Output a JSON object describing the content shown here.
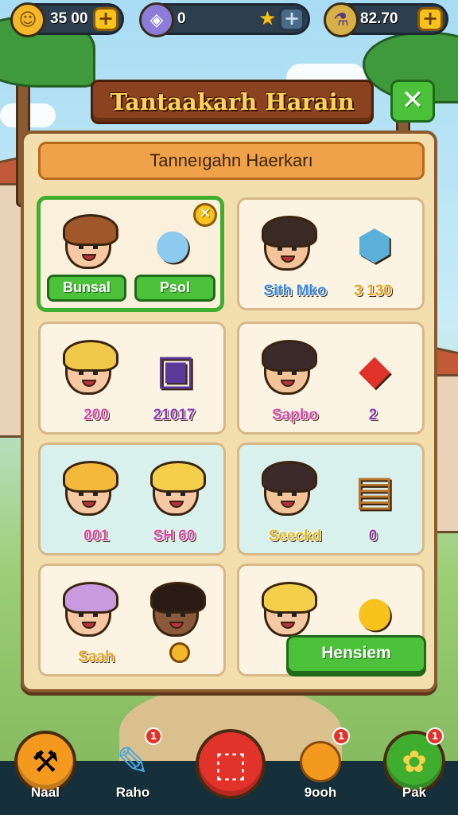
{
  "hud": {
    "coins": {
      "icon": "coin-icon",
      "value": "35 00"
    },
    "gems": {
      "icon": "gem-icon",
      "value": "0"
    },
    "stars": {
      "icon": "star-icon"
    },
    "energy": {
      "icon": "potion-icon",
      "value": "82.70"
    }
  },
  "title": "Tantaakarh Harain",
  "subheader": "Tanneıgahn Haerkarı",
  "cards": [
    {
      "selected": true,
      "left_button": "Bunsal",
      "right_button": "Psol"
    },
    {
      "left_label": "Sith Mko",
      "right_label": "3 130"
    },
    {
      "left_label": "200",
      "right_label": "21017"
    },
    {
      "left_label": "Sapbo",
      "right_label": "2"
    },
    {
      "left_label": "001",
      "right_label": "SH 60"
    },
    {
      "left_label": "Seeckd",
      "right_label": "0"
    },
    {
      "left_label": "Saah"
    },
    {}
  ],
  "action_button": "Hensiem",
  "nav": [
    {
      "label": "Naal",
      "icon": "hammer-icon",
      "color": "#f39a1e"
    },
    {
      "label": "Raho",
      "icon": "map-icon",
      "badge": "1"
    },
    {
      "icon": "box-icon",
      "color": "#e2332a"
    },
    {
      "label": "9ooh",
      "icon": "fruit-icon",
      "badge": "1"
    },
    {
      "label": "Pak",
      "icon": "puzzle-icon",
      "color": "#3fae2e",
      "badge": "1"
    }
  ]
}
